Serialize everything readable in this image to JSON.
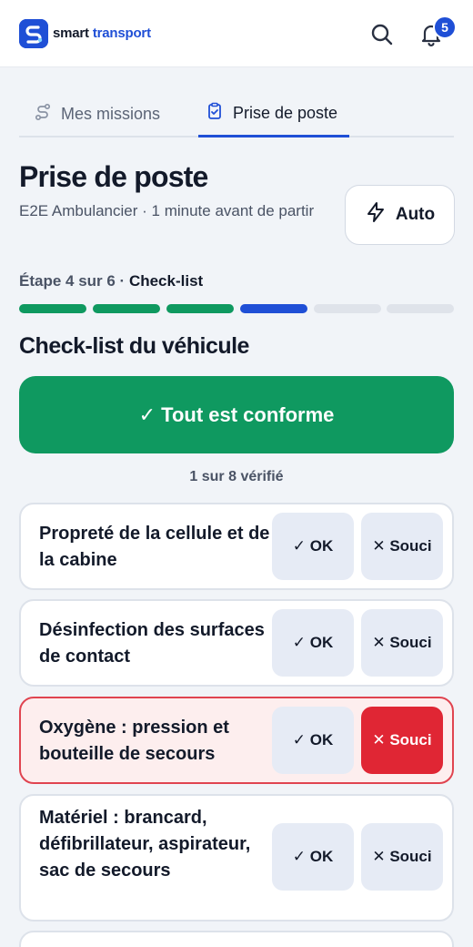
{
  "brand": {
    "name_part1": "smart ",
    "name_part2": "transport"
  },
  "header": {
    "notification_count": "5"
  },
  "tabs": [
    {
      "label": "Mes missions",
      "icon": "route-icon",
      "active": false
    },
    {
      "label": "Prise de poste",
      "icon": "clipboard-check-icon",
      "active": true
    }
  ],
  "page": {
    "title": "Prise de poste",
    "subtitle": "E2E Ambulancier · 1 minute avant de partir",
    "auto_label": "Auto"
  },
  "step": {
    "prefix": "Étape 4 sur 6 · ",
    "name": "Check-list",
    "current": 4,
    "total": 6
  },
  "checklist": {
    "title": "Check-list du véhicule",
    "all_ok_label": "✓ Tout est conforme",
    "verified_text": "1 sur 8 vérifié",
    "ok_label": "✓ OK",
    "souci_label": "✕ Souci",
    "items": [
      {
        "label": "Propreté de la cellule et de la cabine",
        "status": "none"
      },
      {
        "label": "Désinfection des surfaces de contact",
        "status": "none"
      },
      {
        "label": "Oxygène : pression et bouteille de secours",
        "status": "souci"
      },
      {
        "label": "Matériel : brancard, défibrillateur, aspirateur, sac de secours",
        "status": "none"
      }
    ]
  },
  "colors": {
    "primary": "#1f4fd6",
    "success": "#0f9960",
    "danger": "#e02634",
    "issue_bg": "#fdeeee"
  }
}
